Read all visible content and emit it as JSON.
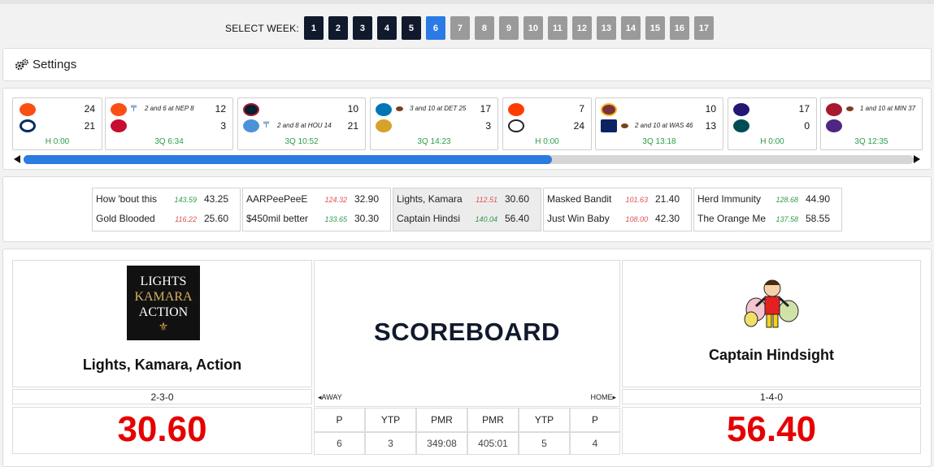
{
  "week_selector": {
    "label": "SELECT WEEK:",
    "weeks": [
      "1",
      "2",
      "3",
      "4",
      "5",
      "6",
      "7",
      "8",
      "9",
      "10",
      "11",
      "12",
      "13",
      "14",
      "15",
      "16",
      "17"
    ],
    "current": "6"
  },
  "settings": {
    "label": "Settings"
  },
  "games": [
    {
      "away_icon": "bengals-logo",
      "home_icon": "colts-logo",
      "away_score": "24",
      "home_score": "21",
      "situation": "",
      "clock": "H 0:00"
    },
    {
      "away_icon": "broncos-logo",
      "home_icon": "patriots-logo",
      "away_score": "12",
      "home_score": "3",
      "situation": "2 and 6 at NEP 8",
      "clock": "3Q 6:34"
    },
    {
      "away_icon": "texans-logo",
      "home_icon": "titans-logo",
      "away_score": "10",
      "home_score": "21",
      "situation": "2 and 8 at HOU 14",
      "clock": "3Q 10:52"
    },
    {
      "away_icon": "lions-logo",
      "home_icon": "jaguars-logo",
      "away_score": "17",
      "home_score": "3",
      "situation": "3 and 10 at DET 25",
      "clock": "3Q 14:23"
    },
    {
      "away_icon": "browns-logo",
      "home_icon": "steelers-logo",
      "away_score": "7",
      "home_score": "24",
      "situation": "",
      "clock": "H 0:00"
    },
    {
      "away_icon": "washington-logo",
      "home_icon": "giants-logo",
      "away_score": "10",
      "home_score": "13",
      "situation": "2 and 10 at WAS 46",
      "clock": "3Q 13:18"
    },
    {
      "away_icon": "ravens-logo",
      "home_icon": "eagles-logo",
      "away_score": "17",
      "home_score": "0",
      "situation": "",
      "clock": "H 0:00"
    },
    {
      "away_icon": "falcons-logo",
      "home_icon": "vikings-logo",
      "away_score": "",
      "home_score": "",
      "situation": "1 and 10 at MIN 37",
      "clock": "3Q 12:35"
    }
  ],
  "matchups": [
    {
      "team1": "How 'bout this",
      "proj1": "143.59",
      "score1": "43.25",
      "team2": "Gold Blooded",
      "proj2": "116.22",
      "score2": "25.60"
    },
    {
      "team1": "AARPeePeeE",
      "proj1": "124.32",
      "score1": "32.90",
      "team2": "$450mil better",
      "proj2": "133.65",
      "score2": "30.30"
    },
    {
      "team1": "Lights, Kamara",
      "proj1": "112.51",
      "score1": "30.60",
      "team2": "Captain Hindsi",
      "proj2": "140.04",
      "score2": "56.40"
    },
    {
      "team1": "Masked Bandit",
      "proj1": "101.63",
      "score1": "21.40",
      "team2": "Just Win Baby",
      "proj2": "108.00",
      "score2": "42.30"
    },
    {
      "team1": "Herd Immunity",
      "proj1": "128.68",
      "score1": "44.90",
      "team2": "The Orange Me",
      "proj2": "137.58",
      "score2": "58.55"
    }
  ],
  "scoreboard": {
    "title": "SCOREBOARD",
    "away_label": "AWAY",
    "home_label": "HOME",
    "away": {
      "name": "Lights, Kamara, Action",
      "logo_text": [
        "LIGHTS",
        "KAMARA",
        "ACTION"
      ],
      "record": "2-3-0",
      "score": "30.60"
    },
    "home": {
      "name": "Captain Hindsight",
      "record": "1-4-0",
      "score": "56.40"
    },
    "stat_headers": [
      "P",
      "YTP",
      "PMR",
      "PMR",
      "YTP",
      "P"
    ],
    "stat_values": [
      "6",
      "3",
      "349:08",
      "405:01",
      "5",
      "4"
    ]
  },
  "colors": {
    "accent": "#2c7be5",
    "past_week": "#111a2c",
    "future_week": "#9a9a9a",
    "score_red": "#e60000",
    "clock_green": "#2a9c4a"
  }
}
